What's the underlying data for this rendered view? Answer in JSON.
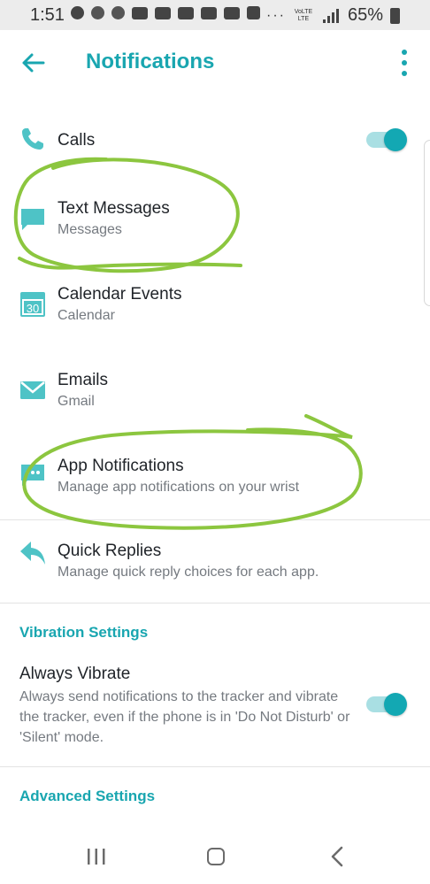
{
  "status_bar": {
    "time": "1:51",
    "battery": "65%",
    "overflow": "···",
    "network": "VoLTE LTE"
  },
  "header": {
    "title": "Notifications"
  },
  "items": [
    {
      "title": "Calls",
      "subtitle": "",
      "icon": "phone-icon"
    },
    {
      "title": "Text Messages",
      "subtitle": "Messages",
      "icon": "message-icon"
    },
    {
      "title": "Calendar Events",
      "subtitle": "Calendar",
      "icon": "calendar-icon",
      "icon_text": "30"
    },
    {
      "title": "Emails",
      "subtitle": "Gmail",
      "icon": "email-icon"
    },
    {
      "title": "App Notifications",
      "subtitle": "Manage app notifications on your wrist",
      "icon": "app-notification-icon"
    }
  ],
  "quick_replies": {
    "title": "Quick Replies",
    "subtitle": "Manage quick reply choices for each app.",
    "icon": "reply-icon"
  },
  "vibration": {
    "section_title": "Vibration Settings",
    "always_vibrate_title": "Always Vibrate",
    "always_vibrate_desc": "Always send notifications to the tracker and vibrate the tracker, even if the phone is in 'Do Not Disturb' or 'Silent' mode.",
    "enabled": true
  },
  "calls_enabled": true,
  "advanced": {
    "section_title": "Advanced Settings"
  },
  "colors": {
    "accent": "#19a6b0",
    "annotation": "#8cc63f"
  }
}
